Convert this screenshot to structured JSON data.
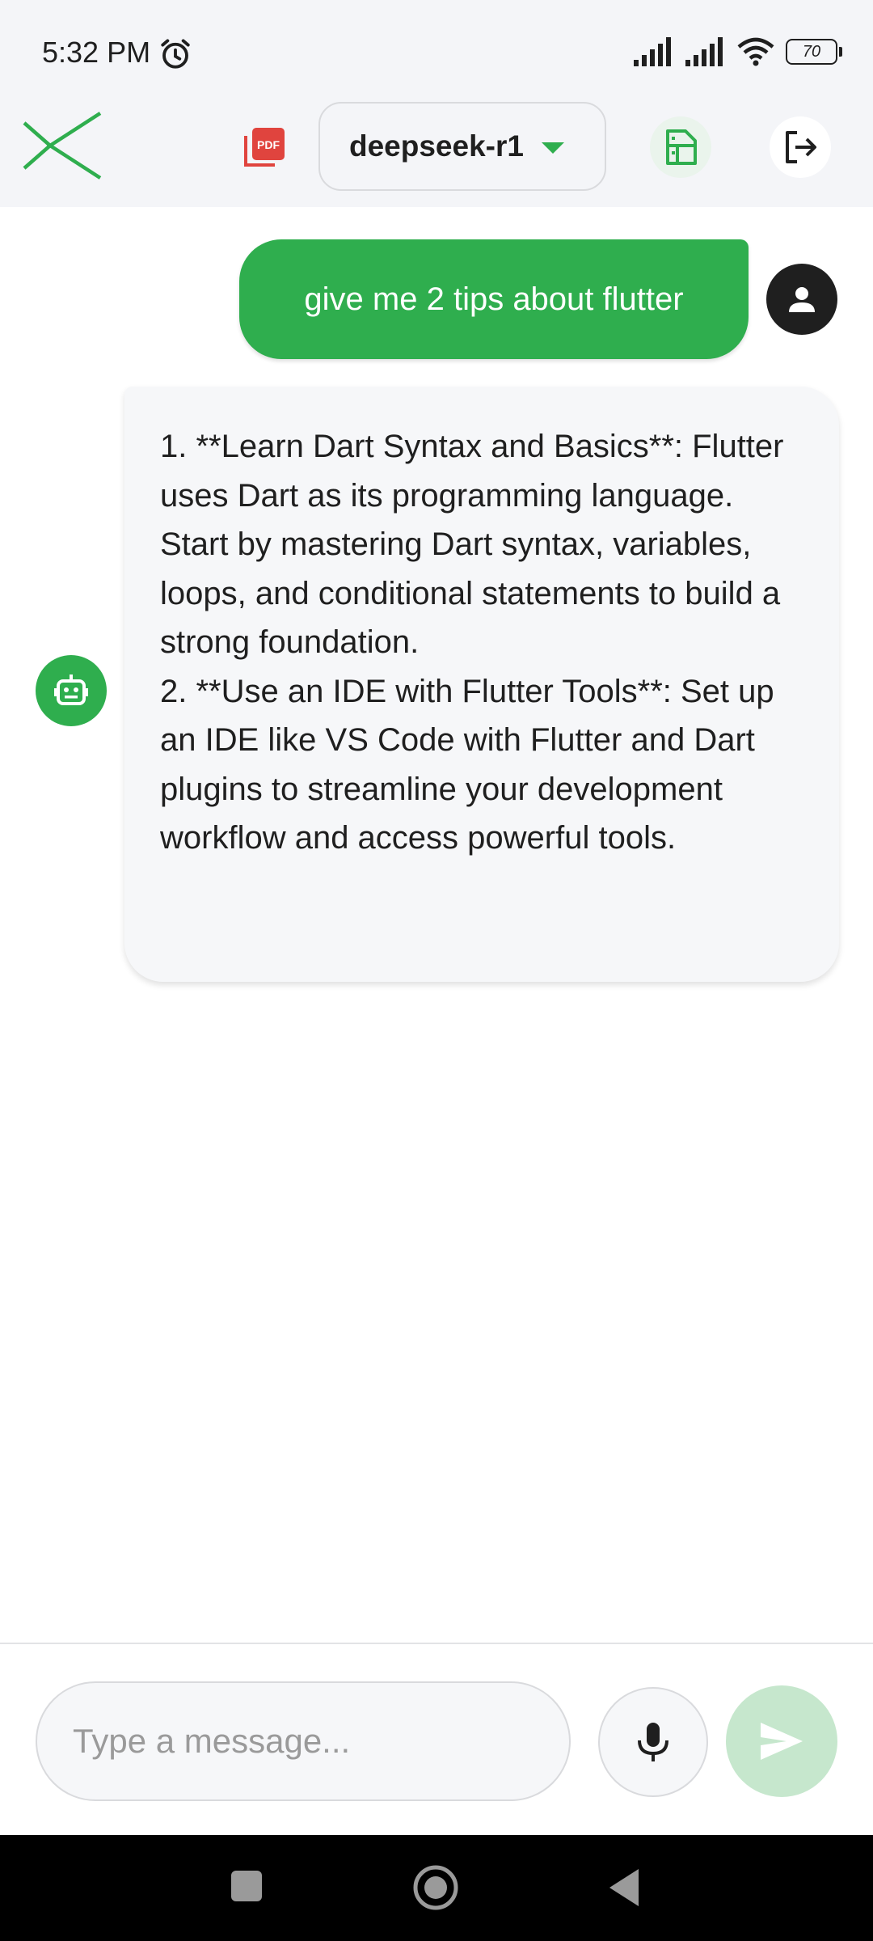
{
  "status_bar": {
    "time": "5:32 PM",
    "battery": "70",
    "icons": [
      "alarm-icon",
      "signal-icon",
      "signal-icon",
      "wifi-icon",
      "battery-icon"
    ]
  },
  "app_bar": {
    "logo_icon": "x-logo-icon",
    "pdf_icon": "pdf-icon",
    "model_label": "deepseek-r1",
    "model_caret_icon": "caret-down-icon",
    "doc_icon": "document-icon",
    "logout_icon": "logout-icon"
  },
  "chat": {
    "messages": [
      {
        "role": "user",
        "text": "give me 2 tips about flutter",
        "avatar_icon": "person-icon"
      },
      {
        "role": "bot",
        "text": "1. **Learn Dart Syntax and Basics**: Flutter uses Dart as its programming language. Start by mastering Dart syntax, variables, loops, and conditional statements to build a strong foundation.\n2. **Use an IDE with Flutter Tools**: Set up an IDE like VS Code with Flutter and Dart plugins to streamline your development workflow and access powerful tools.",
        "avatar_icon": "robot-icon"
      }
    ]
  },
  "input_bar": {
    "placeholder": "Type a message...",
    "value": "",
    "mic_icon": "microphone-icon",
    "send_icon": "send-icon"
  },
  "colors": {
    "accent": "#2fae4e",
    "accent_light": "#c6e7cd",
    "pdf_red": "#e0443e",
    "surface": "#f4f5f8"
  }
}
